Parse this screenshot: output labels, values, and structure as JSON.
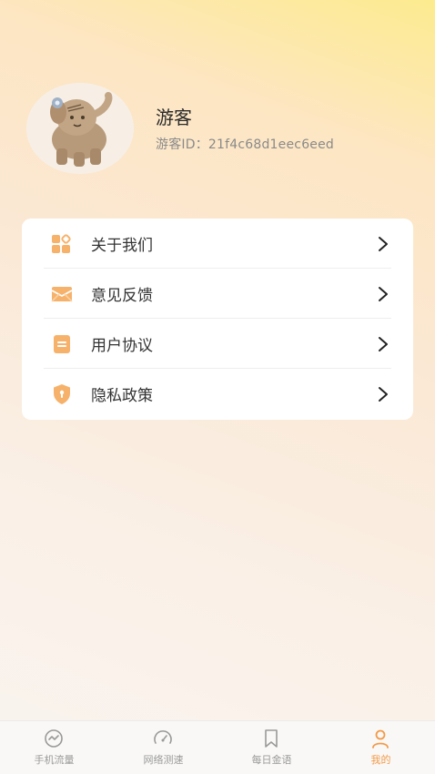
{
  "profile": {
    "name": "游客",
    "id_text": "游客ID：21f4c68d1eec6eed"
  },
  "menu": {
    "items": [
      {
        "label": "关于我们",
        "icon": "apps-grid-icon"
      },
      {
        "label": "意见反馈",
        "icon": "mail-icon"
      },
      {
        "label": "用户协议",
        "icon": "document-icon"
      },
      {
        "label": "隐私政策",
        "icon": "shield-icon"
      }
    ]
  },
  "tabs": [
    {
      "label": "手机流量",
      "icon": "data-usage-icon",
      "active": false
    },
    {
      "label": "网络测速",
      "icon": "speedometer-icon",
      "active": false
    },
    {
      "label": "每日金语",
      "icon": "bookmark-icon",
      "active": false
    },
    {
      "label": "我的",
      "icon": "user-icon",
      "active": true
    }
  ],
  "colors": {
    "accent": "#f39a4a",
    "icon_orange": "#f6b26b",
    "tab_inactive": "#9a9a9a"
  }
}
